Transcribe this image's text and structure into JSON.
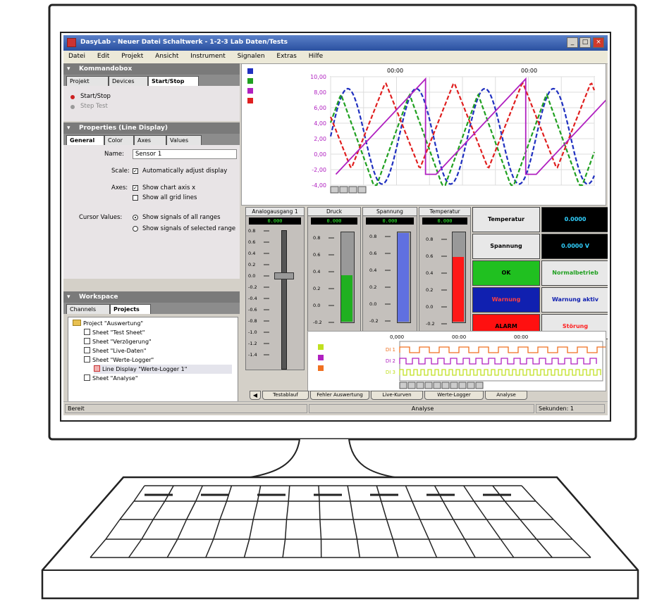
{
  "window": {
    "title": "DasyLab - Neuer Datei Schaltwerk - 1-2-3 Lab Daten/Tests",
    "minimize_label": "_",
    "maximize_label": "□",
    "close_label": "×"
  },
  "menu": [
    "Datei",
    "Edit",
    "Projekt",
    "Ansicht",
    "Instrument",
    "Signalen",
    "Extras",
    "Hilfe"
  ],
  "left": {
    "panel1": {
      "title": "Kommandobox",
      "tabs": [
        "Projekt",
        "Devices",
        "Start/Stop"
      ],
      "items": [
        {
          "label": "Start/Stop",
          "color": "#cc2020"
        },
        {
          "label": "Step Test",
          "color": "#999999"
        }
      ]
    },
    "panel2": {
      "title": "Properties (Line Display)",
      "tabs": [
        "General",
        "Color",
        "Axes",
        "Values"
      ],
      "name_label": "Name:",
      "name_value": "Sensor 1",
      "scale_label": "Scale:",
      "scale_option": "Automatically adjust display",
      "axes_label": "Axes:",
      "axes_opt1": "Show chart axis x",
      "axes_opt2": "Show all grid lines",
      "cursor_label": "Cursor Values:",
      "cursor_opt1": "Show signals of all ranges",
      "cursor_opt2": "Show signals of selected range"
    },
    "panel3": {
      "title": "Workspace",
      "tabs": [
        "Channels",
        "Projects"
      ],
      "tree": [
        "Project \"Auswertung\"",
        "Sheet \"Test Sheet\"",
        "Sheet \"Verzögerung\"",
        "Sheet \"Live-Daten\"",
        "Sheet \"Werte-Logger\"",
        "Line Display \"Werte-Logger 1\"",
        "Sheet \"Analyse\""
      ]
    }
  },
  "chart": {
    "top_labels": [
      "00:00",
      "00:00"
    ],
    "y_ticks": [
      "10,00",
      "8,00",
      "6,00",
      "4,00",
      "2,00",
      "0,00",
      "-2,00",
      "-4,00"
    ],
    "series_colors": [
      "#2030c0",
      "#20a020",
      "#b020c0",
      "#e02020"
    ]
  },
  "instruments": [
    {
      "title": "Analogausgang 1",
      "readout": "0.000"
    },
    {
      "title": "Druck",
      "readout": "0.000"
    },
    {
      "title": "Spannung",
      "readout": "0.000"
    },
    {
      "title": "Temperatur",
      "readout": "0.000"
    }
  ],
  "status_buttons": [
    {
      "label": "Temperatur",
      "bg": "#e8e8e8",
      "fg": "#000000"
    },
    {
      "label": "0.0000",
      "bg": "#000000",
      "fg": "#30d0ff"
    },
    {
      "label": "Spannung",
      "bg": "#e8e8e8",
      "fg": "#000000"
    },
    {
      "label": "0.0000 V",
      "bg": "#000000",
      "fg": "#30d0ff"
    },
    {
      "label": "OK",
      "bg": "#20c020",
      "fg": "#000000"
    },
    {
      "label": "Normalbetrieb",
      "bg": "#e8e8e8",
      "fg": "#20a020"
    },
    {
      "label": "Warnung",
      "bg": "#1020b0",
      "fg": "#ff4040"
    },
    {
      "label": "Warnung aktiv",
      "bg": "#e8e8e8",
      "fg": "#1020b0"
    },
    {
      "label": "ALARM",
      "bg": "#ff1010",
      "fg": "#000000"
    },
    {
      "label": "Störung",
      "bg": "#e8e8e8",
      "fg": "#ff2020"
    }
  ],
  "logic": {
    "labels": [
      "DI 1",
      "DI 2",
      "DI 3"
    ],
    "top_labels": [
      "0,000",
      "00:00",
      "00:00"
    ]
  },
  "bottom_tabs": [
    "Testablauf",
    "Fehler Auswertung",
    "Live-Kurven",
    "Werte-Logger",
    "Analyse"
  ],
  "statusbar": {
    "left": "Bereit",
    "mid": "Analyse",
    "right": "Sekunden: 1"
  }
}
